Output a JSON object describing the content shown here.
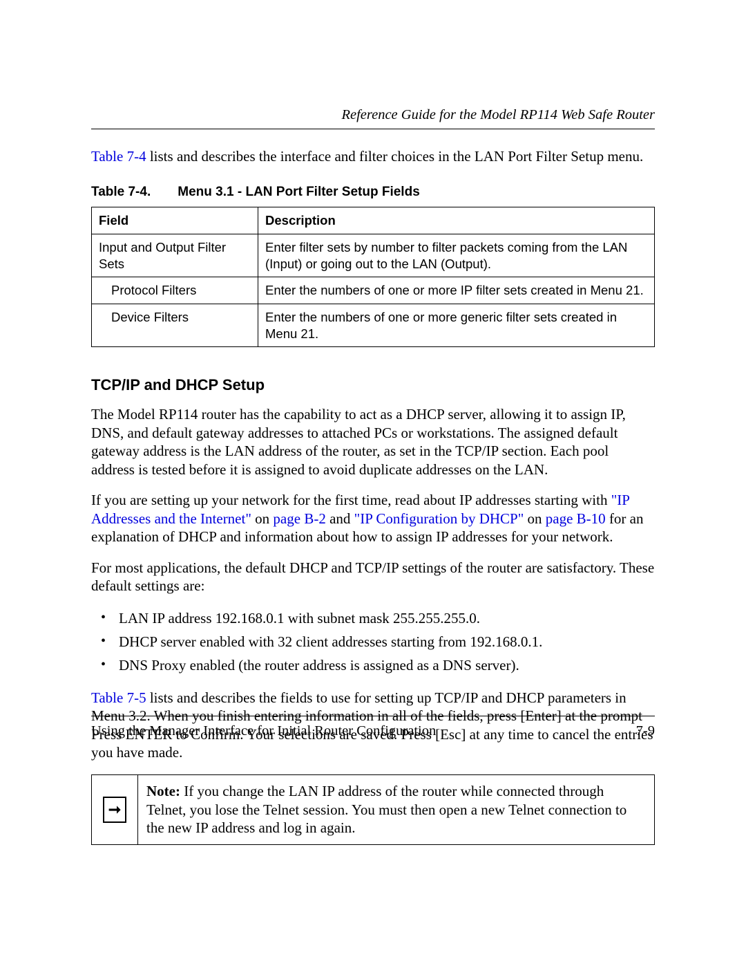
{
  "header": {
    "running_title": "Reference Guide for the Model RP114 Web Safe Router"
  },
  "intro": {
    "table_ref": "Table 7-4",
    "rest": " lists and describes the interface and filter choices in the LAN Port Filter Setup menu."
  },
  "table_caption": {
    "label": "Table 7-4.",
    "title": "Menu 3.1 - LAN Port Filter Setup Fields"
  },
  "table": {
    "head_field": "Field",
    "head_desc": "Description",
    "rows": [
      {
        "field": "Input and Output Filter Sets",
        "desc": "Enter filter sets by number to filter packets coming from the LAN (Input) or going out to the LAN (Output)."
      },
      {
        "field": "Protocol Filters",
        "desc": "Enter the numbers of one or more IP filter sets created in Menu 21.",
        "indent": true
      },
      {
        "field": "Device Filters",
        "desc": "Enter the numbers of one or more generic filter sets created in Menu 21.",
        "indent": true
      }
    ]
  },
  "section": {
    "heading": "TCP/IP and DHCP Setup",
    "p1": "The Model RP114 router has the capability to act as a DHCP server, allowing it to assign IP, DNS, and default gateway addresses to attached PCs or workstations. The assigned default gateway address is the LAN address of the router, as set in the TCP/IP section. Each pool address is tested before it is assigned to avoid duplicate addresses on the LAN.",
    "p2_pre": "If you are setting up your network for the first time, read about IP addresses starting with ",
    "p2_link1": "\"IP Addresses and the Internet\"",
    "p2_mid1": " on ",
    "p2_pageB2": "page B-2",
    "p2_and": " and ",
    "p2_link2": "\"IP Configuration by DHCP\"",
    "p2_mid2": " on ",
    "p2_pageB10": "page B-10",
    "p2_post": " for an explanation of DHCP and information about how to assign IP addresses for your network.",
    "p3": "For most applications, the default DHCP and TCP/IP settings of the router are satisfactory. These default settings are:",
    "bullets": [
      "LAN IP address 192.168.0.1 with subnet mask 255.255.255.0.",
      "DHCP server enabled with 32 client addresses starting from 192.168.0.1.",
      "DNS Proxy enabled (the router address is assigned as a DNS server)."
    ],
    "p4_link": "Table 7-5",
    "p4_rest": " lists and describes the fields to use for setting up TCP/IP and DHCP parameters in Menu 3.2. When you finish entering information in all of the fields, press [Enter] at the prompt Press ENTER to Confirm. Your selections are saved. Press [Esc] at any time to cancel the entries you have made."
  },
  "note": {
    "label": "Note:",
    "text": " If you change the LAN IP address of the router while connected through Telnet, you lose the Telnet session. You must then open a new Telnet connection to the new IP address and log in again."
  },
  "footer": {
    "left": "Using the Manager Interface for Initial Router Configuration",
    "right": "7-9"
  }
}
